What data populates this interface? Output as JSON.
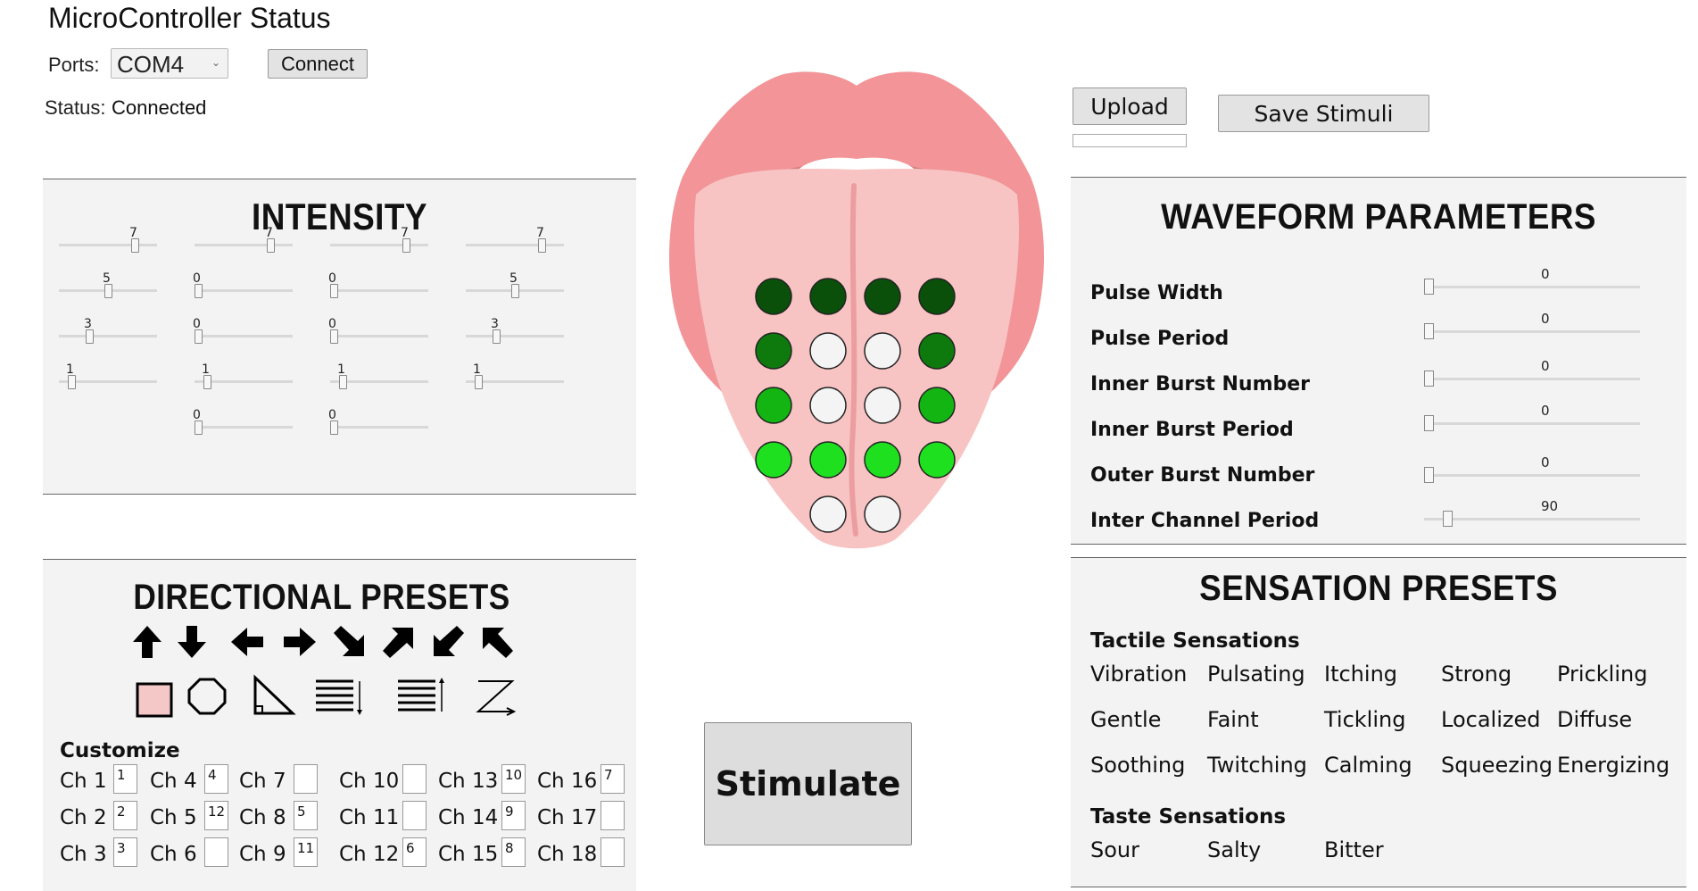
{
  "status": {
    "title": "MicroController Status",
    "ports_label": "Ports:",
    "port_value": "COM4",
    "connect_label": "Connect",
    "status_label": "Status:",
    "status_value": "Connected"
  },
  "intensity": {
    "title": "INTENSITY",
    "values": [
      "7",
      "7",
      "7",
      "7",
      "5",
      "0",
      "0",
      "5",
      "3",
      "0",
      "0",
      "3",
      "1",
      "1",
      "1",
      "1",
      "0",
      "0"
    ],
    "levels": [
      0.8,
      0.8,
      0.8,
      0.8,
      0.5,
      0,
      0,
      0.5,
      0.3,
      0,
      0,
      0.3,
      0.1,
      0.1,
      0.1,
      0.1,
      0,
      0
    ]
  },
  "electrodes": {
    "colors": [
      "#0a4f0a",
      "#0a4f0a",
      "#0a4f0a",
      "#0a4f0a",
      "#0e7a0e",
      "#f4f4f4",
      "#f4f4f4",
      "#0e7a0e",
      "#12b512",
      "#f4f4f4",
      "#f4f4f4",
      "#12b512",
      "#1ee01e",
      "#1ee01e",
      "#1ee01e",
      "#1ee01e",
      "#f4f4f4",
      "#f4f4f4"
    ]
  },
  "buttons": {
    "upload_label": "Upload",
    "save_label": "Save Stimuli",
    "stimulate_label": "Stimulate"
  },
  "waveform": {
    "title": "WAVEFORM PARAMETERS",
    "params": [
      {
        "label": "Pulse Width",
        "value": "0",
        "level": 0
      },
      {
        "label": "Pulse Period",
        "value": "0",
        "level": 0
      },
      {
        "label": "Inner Burst Number",
        "value": "0",
        "level": 0
      },
      {
        "label": "Inner Burst Period",
        "value": "0",
        "level": 0
      },
      {
        "label": "Outer Burst Number",
        "value": "0",
        "level": 0
      },
      {
        "label": "Inter Channel Period",
        "value": "90",
        "level": 0.09
      }
    ]
  },
  "directional": {
    "title": "DIRECTIONAL PRESETS",
    "arrows": [
      "arrow-up-icon",
      "arrow-down-icon",
      "arrow-left-icon",
      "arrow-right-icon",
      "arrow-down-right-icon",
      "arrow-up-right-icon",
      "arrow-down-left-icon",
      "arrow-up-left-icon"
    ],
    "patterns": [
      "square-icon",
      "octagon-icon",
      "triangle-icon",
      "lines-down-icon",
      "lines-up-icon",
      "zigzag-icon"
    ],
    "active_color": "#f5c8c8",
    "customize_label": "Customize",
    "channels": [
      {
        "label": "Ch 1",
        "value": "1"
      },
      {
        "label": "Ch 2",
        "value": "2"
      },
      {
        "label": "Ch 3",
        "value": "3"
      },
      {
        "label": "Ch 4",
        "value": "4"
      },
      {
        "label": "Ch 5",
        "value": "12"
      },
      {
        "label": "Ch 6",
        "value": ""
      },
      {
        "label": "Ch 7",
        "value": ""
      },
      {
        "label": "Ch 8",
        "value": "5"
      },
      {
        "label": "Ch 9",
        "value": "11"
      },
      {
        "label": "Ch 10",
        "value": ""
      },
      {
        "label": "Ch 11",
        "value": ""
      },
      {
        "label": "Ch 12",
        "value": "6"
      },
      {
        "label": "Ch 13",
        "value": "10"
      },
      {
        "label": "Ch 14",
        "value": "9"
      },
      {
        "label": "Ch 15",
        "value": "8"
      },
      {
        "label": "Ch 16",
        "value": "7"
      },
      {
        "label": "Ch 17",
        "value": ""
      },
      {
        "label": "Ch 18",
        "value": ""
      }
    ]
  },
  "sensation": {
    "title": "SENSATION PRESETS",
    "tactile_label": "Tactile Sensations",
    "tactile": [
      "Vibration",
      "Pulsating",
      "Itching",
      "Strong",
      "Prickling",
      "Gentle",
      "Faint",
      "Tickling",
      "Localized",
      "Diffuse",
      "Soothing",
      "Twitching",
      "Calming",
      "Squeezing",
      "Energizing"
    ],
    "taste_label": "Taste Sensations",
    "taste": [
      "Sour",
      "Salty",
      "Bitter"
    ]
  }
}
